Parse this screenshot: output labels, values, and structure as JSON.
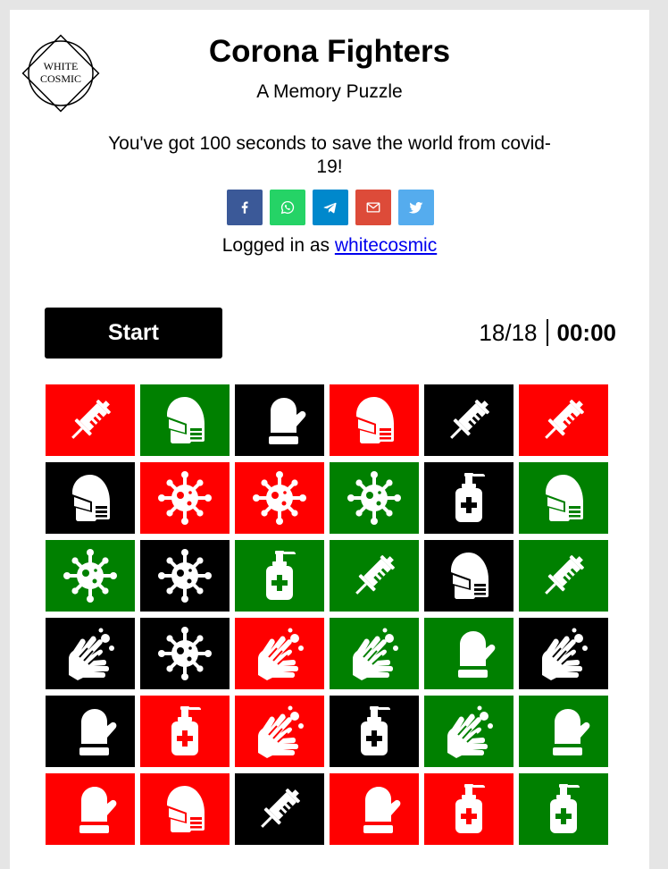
{
  "header": {
    "logo_line1": "WHITE",
    "logo_line2": "COSMIC",
    "title": "Corona Fighters",
    "subtitle": "A Memory Puzzle",
    "tagline": "You've got 100 seconds to save the world from covid-19!"
  },
  "share": [
    {
      "icon": "facebook-icon",
      "color": "#3b5998"
    },
    {
      "icon": "whatsapp-icon",
      "color": "#25d366"
    },
    {
      "icon": "telegram-icon",
      "color": "#0088cc"
    },
    {
      "icon": "email-icon",
      "color": "#dd4b39"
    },
    {
      "icon": "twitter-icon",
      "color": "#55acee"
    }
  ],
  "login": {
    "prefix": "Logged in as ",
    "username": "whitecosmic"
  },
  "controls": {
    "start_label": "Start",
    "pairs": "18/18",
    "timer": "00:00"
  },
  "colors": {
    "red": "#ff0000",
    "green": "#008000",
    "black": "#000000"
  },
  "cards": [
    {
      "color": "red",
      "icon": "syringe"
    },
    {
      "color": "green",
      "icon": "mask"
    },
    {
      "color": "black",
      "icon": "glove"
    },
    {
      "color": "red",
      "icon": "mask"
    },
    {
      "color": "black",
      "icon": "syringe"
    },
    {
      "color": "red",
      "icon": "syringe"
    },
    {
      "color": "black",
      "icon": "mask"
    },
    {
      "color": "red",
      "icon": "virus"
    },
    {
      "color": "red",
      "icon": "virus"
    },
    {
      "color": "green",
      "icon": "virus"
    },
    {
      "color": "black",
      "icon": "sanitizer"
    },
    {
      "color": "green",
      "icon": "mask"
    },
    {
      "color": "green",
      "icon": "virus"
    },
    {
      "color": "black",
      "icon": "virus"
    },
    {
      "color": "green",
      "icon": "sanitizer"
    },
    {
      "color": "green",
      "icon": "syringe"
    },
    {
      "color": "black",
      "icon": "mask"
    },
    {
      "color": "green",
      "icon": "syringe"
    },
    {
      "color": "black",
      "icon": "handwash"
    },
    {
      "color": "black",
      "icon": "virus"
    },
    {
      "color": "red",
      "icon": "handwash"
    },
    {
      "color": "green",
      "icon": "handwash"
    },
    {
      "color": "green",
      "icon": "glove"
    },
    {
      "color": "black",
      "icon": "handwash"
    },
    {
      "color": "black",
      "icon": "glove"
    },
    {
      "color": "red",
      "icon": "sanitizer"
    },
    {
      "color": "red",
      "icon": "handwash"
    },
    {
      "color": "black",
      "icon": "sanitizer"
    },
    {
      "color": "green",
      "icon": "handwash"
    },
    {
      "color": "green",
      "icon": "glove"
    },
    {
      "color": "red",
      "icon": "glove"
    },
    {
      "color": "red",
      "icon": "mask"
    },
    {
      "color": "black",
      "icon": "syringe"
    },
    {
      "color": "red",
      "icon": "glove"
    },
    {
      "color": "red",
      "icon": "sanitizer"
    },
    {
      "color": "green",
      "icon": "sanitizer"
    }
  ]
}
